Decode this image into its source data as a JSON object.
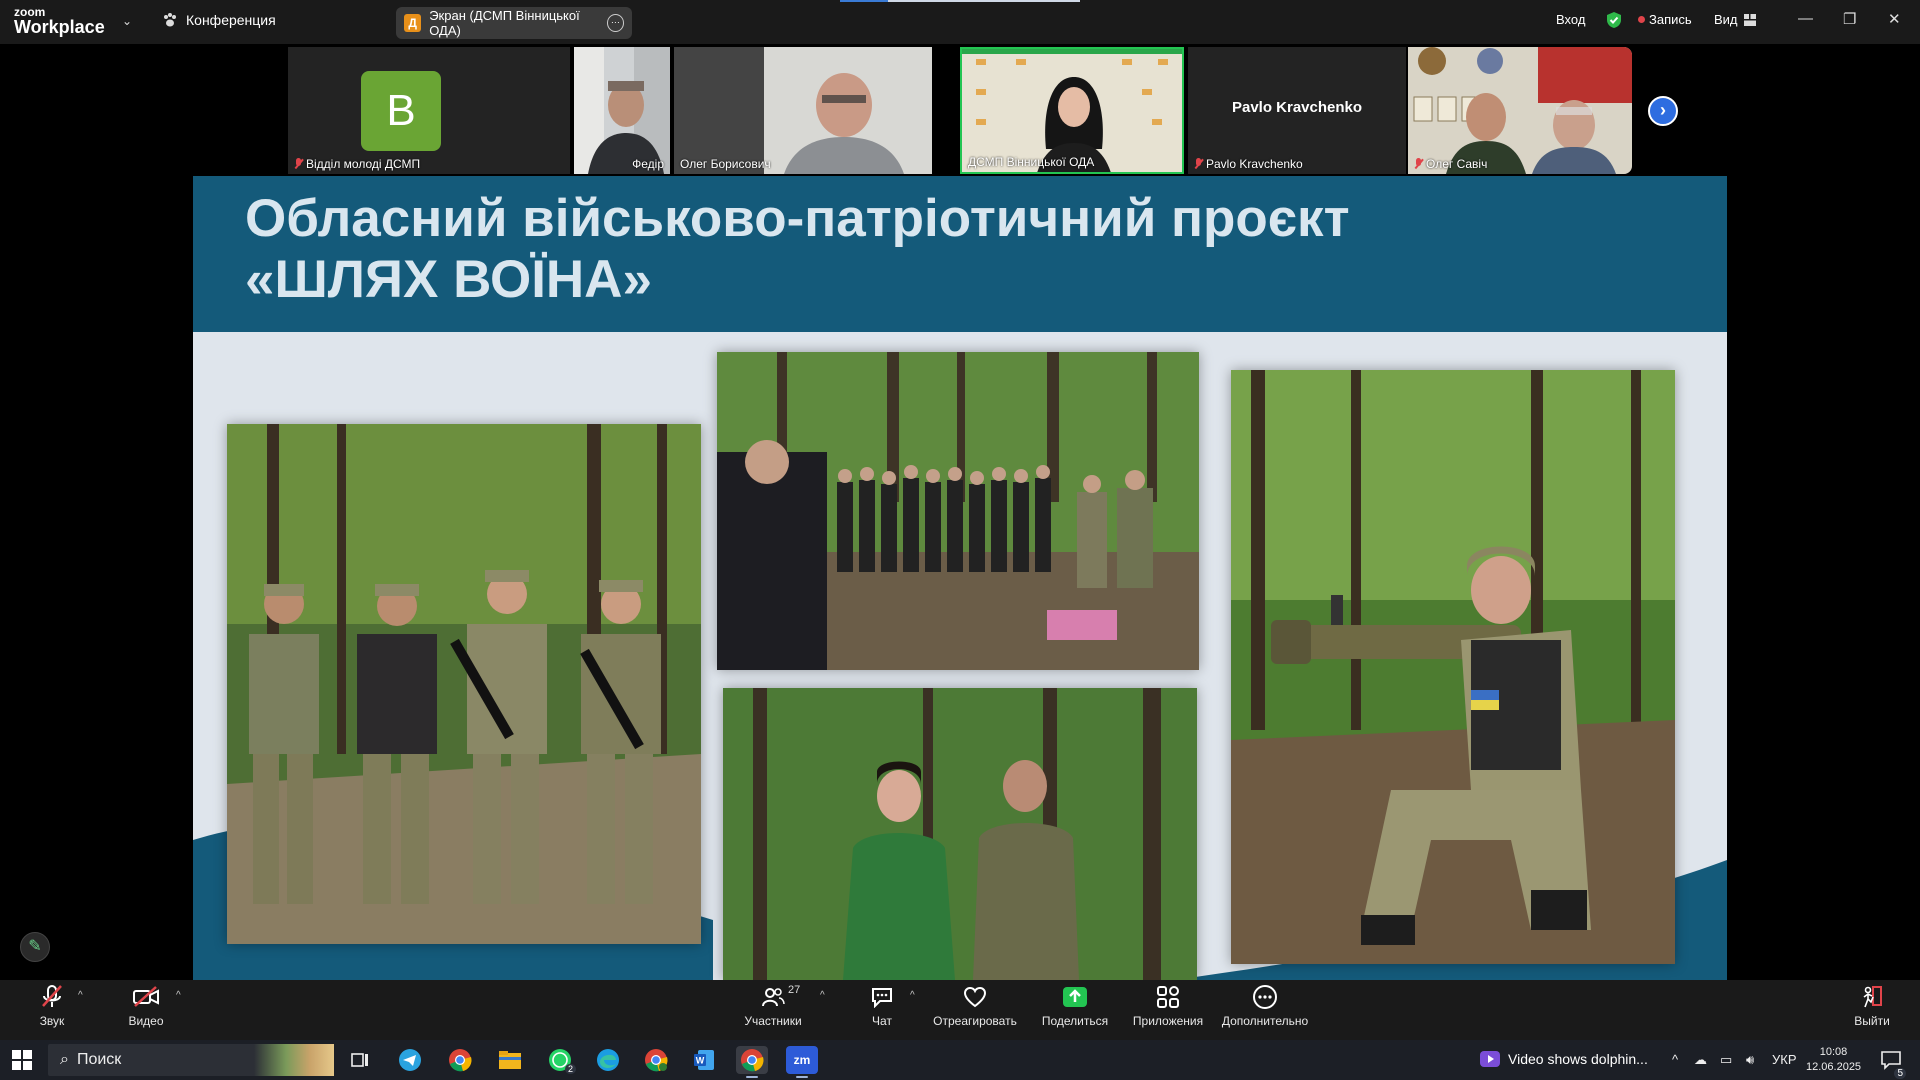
{
  "window": {
    "logo_line1": "zoom",
    "logo_line2": "Workplace",
    "conference_label": "Конференция",
    "screen_share_badge": "Д",
    "screen_share_label": "Экран (ДСМП Вінницької ОДА)",
    "signin_label": "Вход",
    "record_label": "Запись",
    "view_label": "Вид"
  },
  "participants": [
    {
      "name": "Відділ молоді ДСМП",
      "avatar_letter": "B",
      "muted": true
    },
    {
      "name": "Федір",
      "muted": false
    },
    {
      "name": "Олег Борисович",
      "muted": false
    },
    {
      "name": "ДСМП Вінницької ОДА",
      "muted": false,
      "active_speaker": true
    },
    {
      "name": "Pavlo Kravchenko",
      "display_name": "Pavlo Kravchenko",
      "muted": true
    },
    {
      "name": "Олег Савіч",
      "muted": true
    }
  ],
  "slide": {
    "title_line1": "Обласний військово-патріотичний проєкт",
    "title_line2": "«ШЛЯХ ВОЇНА»",
    "header_color": "#145a7a",
    "background_color": "#dfe5ec"
  },
  "toolbar": {
    "audio_label": "Звук",
    "video_label": "Видео",
    "participants_label": "Участники",
    "participants_count": "27",
    "chat_label": "Чат",
    "react_label": "Отреагировать",
    "share_label": "Поделиться",
    "apps_label": "Приложения",
    "more_label": "Дополнительно",
    "leave_label": "Выйти"
  },
  "taskbar": {
    "search_placeholder": "Поиск",
    "whatsapp_badge": "2",
    "notification_text": "Video shows dolphin...",
    "language": "УКР",
    "time": "10:08",
    "date": "12.06.2025",
    "notification_count": "5"
  }
}
